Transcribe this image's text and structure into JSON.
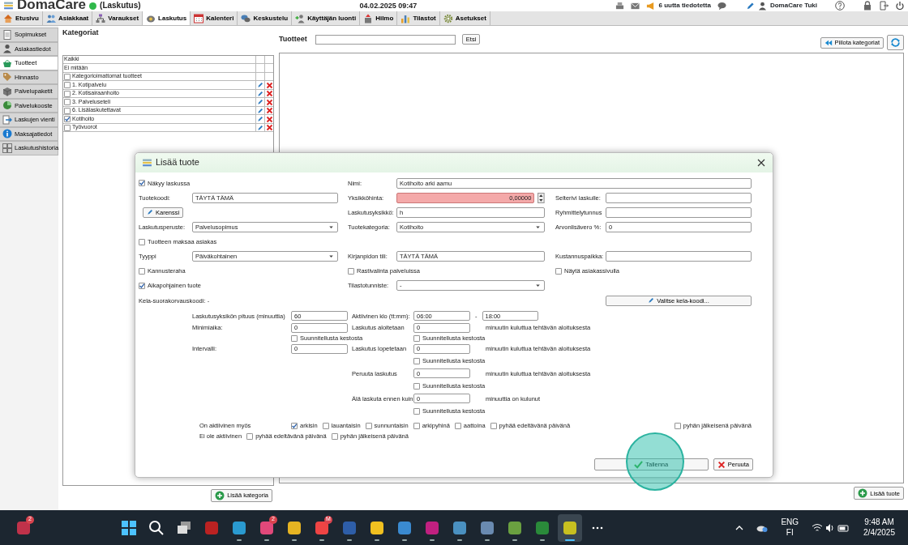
{
  "app": {
    "logo": "DomaCare",
    "module": "(Laskutus)",
    "online": true,
    "datetime": "04.02.2025 09:47",
    "notices": "6 uutta tiedotetta",
    "user": "DomaCare Tuki"
  },
  "nav_tabs": [
    {
      "label": "Etusivu",
      "selected": false
    },
    {
      "label": "Asiakkaat",
      "selected": false
    },
    {
      "label": "Varaukset",
      "selected": false
    },
    {
      "label": "Laskutus",
      "selected": true
    },
    {
      "label": "Kalenteri",
      "selected": false
    },
    {
      "label": "Keskustelu",
      "selected": false
    },
    {
      "label": "Käyttäjän luonti",
      "selected": false
    },
    {
      "label": "Hilmo",
      "selected": false
    },
    {
      "label": "Tilastot",
      "selected": false
    },
    {
      "label": "Asetukset",
      "selected": false
    }
  ],
  "sidebar": {
    "items": [
      {
        "label": "Sopimukset",
        "selected": false
      },
      {
        "label": "Asiakastiedot",
        "selected": false
      },
      {
        "label": "Tuotteet",
        "selected": true
      },
      {
        "label": "Hinnasto",
        "selected": false
      },
      {
        "label": "Palvelupaketit",
        "selected": false
      },
      {
        "label": "Palvelukooste",
        "selected": false
      },
      {
        "label": "Laskujen vienti",
        "selected": false
      },
      {
        "label": "Maksajatiedot",
        "selected": false
      },
      {
        "label": "Laskutushistoria",
        "selected": false
      }
    ]
  },
  "categories": {
    "title": "Kategoriat",
    "rows": [
      {
        "kind": "plain",
        "label": "Kaikki"
      },
      {
        "kind": "plain",
        "label": "Ei mitään"
      },
      {
        "kind": "check",
        "label": "Kategorioimattomat tuotteet",
        "checked": false
      },
      {
        "kind": "editable",
        "label": "1. Kotipalvelu",
        "checked": false
      },
      {
        "kind": "editable",
        "label": "2. Kotisairaanhoito",
        "checked": false
      },
      {
        "kind": "editable",
        "label": "3. Palveluseteli",
        "checked": false
      },
      {
        "kind": "editable",
        "label": "6. Lisälaskutettavat",
        "checked": false
      },
      {
        "kind": "editable",
        "label": "Kotihoito",
        "checked": true
      },
      {
        "kind": "editable",
        "label": "Työvuorot",
        "checked": false
      }
    ],
    "add_button": "Lisää kategoria"
  },
  "products": {
    "title": "Tuotteet",
    "search_button": "Etsi",
    "hide_button": "Piilota kategoriat",
    "add_button": "Lisää tuote"
  },
  "dialog": {
    "title": "Lisää tuote",
    "rows": [
      {
        "left": {
          "kind": "checkbox",
          "label": "Näkyy laskussa",
          "checked": true
        },
        "middle": {
          "kind": "field",
          "label": "Nimi:",
          "value": "Kotihoito arki aamu"
        }
      },
      {
        "left": {
          "kind": "field",
          "label": "Tuotekoodi:",
          "value": "TÄYTÄ TÄMÄ"
        },
        "middle": {
          "kind": "spinner",
          "label": "Yksikköhinta:",
          "value": "0,00000",
          "invalid": true
        },
        "right": {
          "kind": "field",
          "label": "Selterivi laskulle:"
        }
      },
      {
        "left": {
          "kind": "button",
          "label": "Karenssi"
        },
        "middle": {
          "kind": "field",
          "label": "Laskutusyksikkö:",
          "value": "h"
        },
        "right": {
          "kind": "field",
          "label": "Ryhmittelytunnus"
        }
      },
      {
        "left": {
          "kind": "select",
          "label": "Laskutusperuste:",
          "value": "Palvelusopimus"
        },
        "middle": {
          "kind": "select",
          "label": "Tuotekategoria:",
          "value": "Kotihoito"
        },
        "right": {
          "kind": "field",
          "label": "Arvonlisävero %:",
          "value": "0"
        }
      },
      {
        "left": {
          "kind": "checkbox",
          "label": "Tuotteen maksaa asiakas",
          "checked": false
        }
      },
      {
        "left": {
          "kind": "select",
          "label": "Tyyppi",
          "value": "Päiväkohtainen"
        },
        "middle": {
          "kind": "field",
          "label": "Kirjanpidon tili:",
          "value": "TÄYTÄ TÄMÄ"
        },
        "right": {
          "kind": "field",
          "label": "Kustannuspaikka:"
        }
      },
      {
        "left": {
          "kind": "checkbox",
          "label": "Kannusteraha",
          "checked": false
        },
        "middle": {
          "kind": "checkbox",
          "label": "Rastivalinta palveluissa",
          "checked": false
        },
        "right": {
          "kind": "checkbox",
          "label": "Näytä asiakassivulla",
          "checked": false
        }
      },
      {
        "left": {
          "kind": "checkbox",
          "label": "Aikapohjainen tuote",
          "checked": true
        },
        "middle": {
          "kind": "select",
          "label": "Tilastotunniste:",
          "value": "-"
        }
      },
      {
        "left": {
          "kind": "text",
          "label": "Kela-suorakorvauskoodi: -"
        },
        "right": {
          "kind": "button",
          "label": "Valitse kela-koodi..."
        }
      }
    ],
    "timing": [
      {
        "left": {
          "kind": "field",
          "label": "Laskutusyksikön pituus (minuuttia)",
          "value": "60"
        },
        "right": {
          "kind": "range",
          "label": "Aktiivinen klo (tt:mm):",
          "value": "06:00",
          "separator": "-",
          "value_end": "18:00"
        }
      },
      {
        "left": {
          "kind": "field",
          "label": "Minimiaika:",
          "value": "0"
        },
        "right": {
          "kind": "field",
          "label": "Laskutus aloitetaan",
          "value": "0",
          "suffix": "minuutin kuluttua tehtävän aloituksesta"
        }
      },
      {
        "left": {
          "kind": "checkbox",
          "label": "Suunnitellusta kestosta",
          "checked": false
        },
        "right": {
          "kind": "checkbox",
          "label": "Suunnitellusta kestosta",
          "checked": false
        }
      },
      {
        "left": {
          "kind": "field",
          "label": "Intervalli:",
          "value": "0"
        },
        "right": {
          "kind": "field",
          "label": "Laskutus lopetetaan",
          "value": "0",
          "suffix": "minuutin kuluttua tehtävän aloituksesta"
        }
      },
      {
        "right": {
          "kind": "checkbox",
          "label": "Suunnitellusta kestosta",
          "checked": false
        }
      },
      {
        "right": {
          "kind": "field",
          "label": "Peruuta laskutus",
          "value": "0",
          "suffix": "minuutin kuluttua tehtävän aloituksesta"
        }
      },
      {
        "right": {
          "kind": "checkbox",
          "label": "Suunnitellusta kestosta",
          "checked": false
        }
      },
      {
        "right": {
          "kind": "field",
          "label": "Älä laskuta ennen kuin",
          "value": "0",
          "suffix": "minuuttia on kulunut"
        }
      },
      {
        "right": {
          "kind": "checkbox",
          "label": "Suunnitellusta kestosta",
          "checked": false
        }
      }
    ],
    "day_groups": [
      {
        "label": "On aktiivinen myös",
        "options": [
          {
            "label": "arkisin",
            "checked": true
          },
          {
            "label": "lauantaisin",
            "checked": false
          },
          {
            "label": "sunnuntaisin",
            "checked": false
          },
          {
            "label": "arkipyhinä",
            "checked": false
          },
          {
            "label": "aattoina",
            "checked": false
          },
          {
            "label": "pyhää edeltävänä päivänä",
            "checked": false
          },
          {
            "label": "pyhän jälkeisenä päivänä",
            "checked": false
          }
        ]
      },
      {
        "label": "Ei ole aktiivinen",
        "options": [
          {
            "label": "pyhää edeltävänä päivänä",
            "checked": false
          },
          {
            "label": "pyhän jälkeisenä päivänä",
            "checked": false
          }
        ]
      }
    ],
    "save": "Tallenna",
    "cancel": "Peruuta"
  },
  "taskbar": {
    "apps": [
      {
        "badge": "2",
        "running": false,
        "selected": false
      },
      {
        "running": false,
        "selected": false
      },
      {
        "running": false,
        "selected": false
      },
      {
        "running": false,
        "selected": false
      },
      {
        "running": false,
        "selected": false
      },
      {
        "running": true,
        "selected": false
      },
      {
        "badge": "2",
        "running": true,
        "selected": false
      },
      {
        "running": true,
        "selected": false
      },
      {
        "badge": "M",
        "running": true,
        "selected": false
      },
      {
        "running": true,
        "selected": false
      },
      {
        "running": true,
        "selected": false
      },
      {
        "running": true,
        "selected": false
      },
      {
        "running": true,
        "selected": false
      },
      {
        "running": true,
        "selected": false
      },
      {
        "running": true,
        "selected": false
      },
      {
        "running": true,
        "selected": false
      },
      {
        "running": true,
        "selected": false
      },
      {
        "running": true,
        "selected": true
      }
    ],
    "lang": "ENG",
    "layout": "FI",
    "time": "9:48 AM",
    "date": "2/4/2025"
  }
}
